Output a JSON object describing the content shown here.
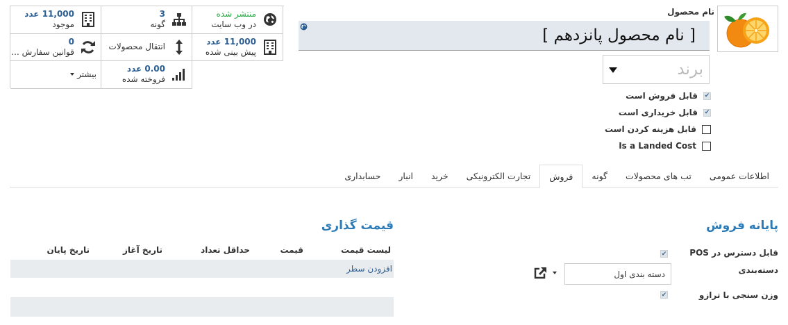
{
  "stats": {
    "published": {
      "value": "منتشر شده",
      "label": "در وب سایت"
    },
    "variants": {
      "value": "3",
      "label": "گونه"
    },
    "on_hand": {
      "value": "11,000 عدد",
      "label": "موجود"
    },
    "forecasted": {
      "value": "11,000 عدد",
      "label": "پیش بینی شده"
    },
    "transfers": {
      "label": "انتقال محصولات"
    },
    "reorder": {
      "value": "0",
      "label": "قوانین سفارش ..."
    },
    "sold": {
      "value": "0.00 عدد",
      "label": "فروخته شده"
    },
    "more": {
      "label": "بیشتر"
    }
  },
  "product": {
    "name_label": "نام محصول",
    "name": "[ نام محصول پانزدهم ]",
    "brand_placeholder": "برند"
  },
  "checkboxes": [
    {
      "label": "قابل فروش است",
      "checked": true
    },
    {
      "label": "قابل خریداری است",
      "checked": true
    },
    {
      "label": "قابل هزینه کردن است",
      "checked": false
    },
    {
      "label": "Is a Landed Cost",
      "checked": false
    }
  ],
  "tabs": [
    "اطلاعات عمومی",
    "تب های محصولات",
    "گونه",
    "فروش",
    "تجارت الکترونیکی",
    "خرید",
    "انبار",
    "حسابداری"
  ],
  "active_tab": "فروش",
  "pos": {
    "title": "پایانه فروش",
    "available_label": "قابل دسترس در POS",
    "category_label": "دسته‌بندی",
    "category_value": "دسته بندی اول",
    "weight_label": "وزن سنجی با ترازو"
  },
  "pricing": {
    "title": "قیمت گذاری",
    "columns": [
      "لیست قیمت",
      "قیمت",
      "حداقل تعداد",
      "تاریخ آغاز",
      "تاریخ پایان"
    ],
    "add_line": "افزودن سطر"
  },
  "colors": {
    "accent": "#2c7ab6",
    "link": "#2c5f93",
    "green": "#28a745"
  }
}
